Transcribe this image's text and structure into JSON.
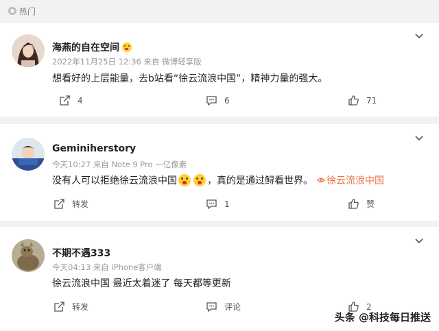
{
  "header": {
    "label": "热门"
  },
  "comments": [
    {
      "username": "海燕的自在空间",
      "meta": "2022年11月25日 12:36 来自 微博轻享版",
      "content": "想看好的上层能量，去b站看“徐云流浪中国”，精神力量的强大。",
      "forward_label": "4",
      "comment_label": "6",
      "like_label": "71"
    },
    {
      "username": "Geminiherstory",
      "meta": "今天10:27 来自 Note 9 Pro 一亿像素",
      "content_prefix": "没有人可以拒绝徐云流浪中国",
      "content_suffix": "，真的是通过鲟看世界。",
      "topic": "徐云流浪中国",
      "forward_label": "转发",
      "comment_label": "1",
      "like_label": "赞"
    },
    {
      "username": "不期不遇333",
      "meta": "今天04:13 来自 iPhone客户端",
      "content": "徐云流浪中国 最近太着迷了 每天都等更新",
      "forward_label": "转发",
      "comment_label": "评论",
      "like_label": "2"
    }
  ],
  "watermark": "头条 @科技每日推送",
  "icons": {
    "hot": "hot-icon",
    "forward": "forward-icon",
    "comment": "comment-icon",
    "like": "like-icon",
    "more": "chevron-down-icon",
    "topic": "topic-icon"
  },
  "colors": {
    "topic": "#eb7340",
    "background": "#f2f2f2",
    "card": "#ffffff"
  }
}
